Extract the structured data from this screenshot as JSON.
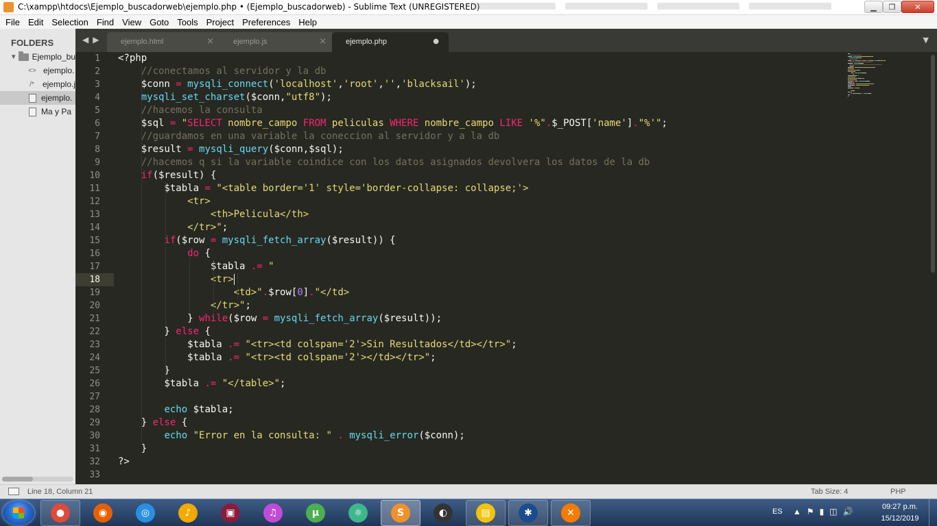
{
  "window": {
    "title": "C:\\xampp\\htdocs\\Ejemplo_buscadorweb\\ejemplo.php • (Ejemplo_buscadorweb) - Sublime Text (UNREGISTERED)",
    "icon": "sublime-icon"
  },
  "menu": [
    "File",
    "Edit",
    "Selection",
    "Find",
    "View",
    "Goto",
    "Tools",
    "Project",
    "Preferences",
    "Help"
  ],
  "sidebar": {
    "title": "FOLDERS",
    "folder": "Ejemplo_bu",
    "files": [
      {
        "label": "ejemplo.",
        "icon": "html-icon",
        "glyph": "<>",
        "selected": false
      },
      {
        "label": "ejemplo.j",
        "icon": "js-icon",
        "glyph": "/*",
        "selected": false
      },
      {
        "label": "ejemplo.",
        "icon": "file-icon",
        "glyph": "",
        "selected": true
      },
      {
        "label": "Ma y Pa",
        "icon": "file-icon",
        "glyph": "",
        "selected": false
      }
    ]
  },
  "tabs": [
    {
      "label": "ejemplo.html",
      "active": false
    },
    {
      "label": "ejemplo.js",
      "active": false
    },
    {
      "label": "ejemplo.php",
      "active": true,
      "dirty": true
    }
  ],
  "editor": {
    "current_line": 18,
    "lines": [
      [
        [
          "<?php",
          ""
        ]
      ],
      [
        [
          "    ",
          ""
        ],
        [
          "//conectamos al servidor y la db",
          "cmt"
        ]
      ],
      [
        [
          "    $conn ",
          ""
        ],
        [
          "=",
          "kw"
        ],
        [
          " ",
          ""
        ],
        [
          "mysqli_connect",
          "fn"
        ],
        [
          "(",
          ""
        ],
        [
          "'localhost'",
          "str"
        ],
        [
          ",",
          ""
        ],
        [
          "'root'",
          "str"
        ],
        [
          ",",
          ""
        ],
        [
          "''",
          "str"
        ],
        [
          ",",
          ""
        ],
        [
          "'blacksail'",
          "str"
        ],
        [
          ");",
          ""
        ]
      ],
      [
        [
          "    ",
          ""
        ],
        [
          "mysqli_set_charset",
          "fn"
        ],
        [
          "($conn,",
          ""
        ],
        [
          "\"utf8\"",
          "str"
        ],
        [
          ");",
          ""
        ]
      ],
      [
        [
          "    ",
          ""
        ],
        [
          "//hacemos la consulta",
          "cmt"
        ]
      ],
      [
        [
          "    $sql ",
          ""
        ],
        [
          "=",
          "kw"
        ],
        [
          " ",
          ""
        ],
        [
          "\"",
          "str"
        ],
        [
          "SELECT",
          "kw"
        ],
        [
          " nombre_campo ",
          "str"
        ],
        [
          "FROM",
          "kw"
        ],
        [
          " peliculas ",
          "str"
        ],
        [
          "WHERE",
          "kw"
        ],
        [
          " nombre_campo ",
          "str"
        ],
        [
          "LIKE",
          "kw"
        ],
        [
          " '%\"",
          "str"
        ],
        [
          ".",
          "kw"
        ],
        [
          "$_POST[",
          ""
        ],
        [
          "'name'",
          "str"
        ],
        [
          "]",
          ""
        ],
        [
          ".",
          "kw"
        ],
        [
          "\"%'\"",
          "str"
        ],
        [
          ";",
          ""
        ]
      ],
      [
        [
          "    ",
          ""
        ],
        [
          "//guardamos en una variable la coneccion al servidor y a la db",
          "cmt"
        ]
      ],
      [
        [
          "    $result ",
          ""
        ],
        [
          "=",
          "kw"
        ],
        [
          " ",
          ""
        ],
        [
          "mysqli_query",
          "fn"
        ],
        [
          "($conn,$sql);",
          ""
        ]
      ],
      [
        [
          "    ",
          ""
        ],
        [
          "//hacemos q si la variable coindice con los datos asignados devolvera los datos de la db",
          "cmt"
        ]
      ],
      [
        [
          "    ",
          ""
        ],
        [
          "if",
          "kw"
        ],
        [
          "($result) {",
          ""
        ]
      ],
      [
        [
          "        $tabla ",
          ""
        ],
        [
          "=",
          "kw"
        ],
        [
          " ",
          ""
        ],
        [
          "\"<table border='1' style='border-collapse: collapse;'>",
          "str"
        ]
      ],
      [
        [
          "            <tr>",
          "str"
        ]
      ],
      [
        [
          "                <th>Pelicula</th>",
          "str"
        ]
      ],
      [
        [
          "            </tr>\"",
          "str"
        ],
        [
          ";",
          ""
        ]
      ],
      [
        [
          "        ",
          ""
        ],
        [
          "if",
          "kw"
        ],
        [
          "($row ",
          ""
        ],
        [
          "=",
          "kw"
        ],
        [
          " ",
          ""
        ],
        [
          "mysqli_fetch_array",
          "fn"
        ],
        [
          "($result)) {",
          ""
        ]
      ],
      [
        [
          "            ",
          ""
        ],
        [
          "do",
          "kw"
        ],
        [
          " {",
          ""
        ]
      ],
      [
        [
          "                $tabla ",
          ""
        ],
        [
          ".=",
          "kw"
        ],
        [
          " ",
          ""
        ],
        [
          "\"",
          "str"
        ]
      ],
      [
        [
          "                <tr>",
          "str"
        ],
        [
          "|caret",
          "caret"
        ]
      ],
      [
        [
          "                    <td>\"",
          "str"
        ],
        [
          ".",
          "kw"
        ],
        [
          "$row[",
          ""
        ],
        [
          "0",
          "num"
        ],
        [
          "]",
          ""
        ],
        [
          ".",
          "kw"
        ],
        [
          "\"</td>",
          "str"
        ]
      ],
      [
        [
          "                </tr>\"",
          "str"
        ],
        [
          ";",
          ""
        ]
      ],
      [
        [
          "            } ",
          ""
        ],
        [
          "while",
          "kw"
        ],
        [
          "($row ",
          ""
        ],
        [
          "=",
          "kw"
        ],
        [
          " ",
          ""
        ],
        [
          "mysqli_fetch_array",
          "fn"
        ],
        [
          "($result));",
          ""
        ]
      ],
      [
        [
          "        } ",
          ""
        ],
        [
          "else",
          "kw"
        ],
        [
          " {",
          ""
        ]
      ],
      [
        [
          "            $tabla ",
          ""
        ],
        [
          ".=",
          "kw"
        ],
        [
          " ",
          ""
        ],
        [
          "\"<tr><td colspan='2'>Sin Resultados</td></tr>\"",
          "str"
        ],
        [
          ";",
          ""
        ]
      ],
      [
        [
          "            $tabla ",
          ""
        ],
        [
          ".=",
          "kw"
        ],
        [
          " ",
          ""
        ],
        [
          "\"<tr><td colspan='2'></td></tr>\"",
          "str"
        ],
        [
          ";",
          ""
        ]
      ],
      [
        [
          "        }",
          ""
        ]
      ],
      [
        [
          "        $tabla ",
          ""
        ],
        [
          ".=",
          "kw"
        ],
        [
          " ",
          ""
        ],
        [
          "\"</table>\"",
          "str"
        ],
        [
          ";",
          ""
        ]
      ],
      [
        [
          "",
          ""
        ]
      ],
      [
        [
          "        ",
          ""
        ],
        [
          "echo",
          "fn"
        ],
        [
          " $tabla;",
          ""
        ]
      ],
      [
        [
          "    } ",
          ""
        ],
        [
          "else",
          "kw"
        ],
        [
          " {",
          ""
        ]
      ],
      [
        [
          "        ",
          ""
        ],
        [
          "echo",
          "fn"
        ],
        [
          " ",
          ""
        ],
        [
          "\"Error en la consulta: \"",
          "str"
        ],
        [
          " ",
          ""
        ],
        [
          ".",
          "kw"
        ],
        [
          " ",
          ""
        ],
        [
          "mysqli_error",
          "fn"
        ],
        [
          "($conn);",
          ""
        ]
      ],
      [
        [
          "    }",
          ""
        ]
      ],
      [
        [
          "?>",
          ""
        ]
      ],
      [
        [
          "",
          ""
        ]
      ]
    ]
  },
  "status": {
    "position": "Line 18, Column 21",
    "tab_size": "Tab Size: 4",
    "syntax": "PHP"
  },
  "taskbar": {
    "apps": [
      {
        "name": "chrome",
        "color": "#dd4b39",
        "glyph": "●",
        "state": "running"
      },
      {
        "name": "firefox",
        "color": "#e66000",
        "glyph": "◉",
        "state": ""
      },
      {
        "name": "safari",
        "color": "#2a8fe0",
        "glyph": "◎",
        "state": ""
      },
      {
        "name": "fl-studio",
        "color": "#f2a900",
        "glyph": "♪",
        "state": ""
      },
      {
        "name": "winrar",
        "color": "#8b1c3c",
        "glyph": "▣",
        "state": ""
      },
      {
        "name": "itunes",
        "color": "#c14bd9",
        "glyph": "♫",
        "state": ""
      },
      {
        "name": "utorrent",
        "color": "#4caf50",
        "glyph": "µ",
        "state": ""
      },
      {
        "name": "atom",
        "color": "#3fb68b",
        "glyph": "⚛",
        "state": ""
      },
      {
        "name": "sublime-text",
        "color": "#f0922b",
        "glyph": "S",
        "state": "active"
      },
      {
        "name": "obs",
        "color": "#333333",
        "glyph": "◐",
        "state": ""
      },
      {
        "name": "file-explorer",
        "color": "#f1c40f",
        "glyph": "▤",
        "state": "running"
      },
      {
        "name": "media-app",
        "color": "#1b4c8c",
        "glyph": "✱",
        "state": "running"
      },
      {
        "name": "xampp",
        "color": "#f57c00",
        "glyph": "✕",
        "state": "running"
      }
    ],
    "tray": {
      "language": "ES",
      "time": "09:27 p.m.",
      "date": "15/12/2019"
    }
  }
}
